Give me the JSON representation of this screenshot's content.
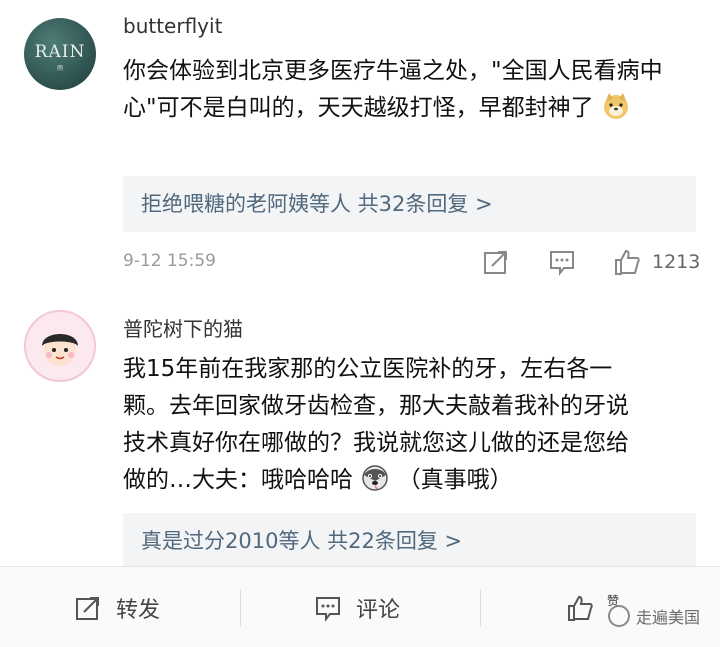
{
  "comments": [
    {
      "username": "butterflyit",
      "avatar_text": "RAIN",
      "avatar_subtext": "雨",
      "text": "你会体验到北京更多医疗牛逼之处，\"全国人民看病中心\"可不是白叫的，天天越级打怪，早都封神了",
      "emoji": "doge-emoji",
      "replies_summary": "拒绝喂糖的老阿姨等人  共32条回复 >",
      "timestamp": "9-12 15:59",
      "like_count": "1213"
    },
    {
      "username": "普陀树下的猫",
      "text_line1": "我15年前在我家那的公立医院补的牙，左右各一",
      "text_line2": "颗。去年回家做牙齿检查，那大夫敲着我补的牙说",
      "text_line3": "技术真好你在哪做的？我说就您这儿做的还是您给",
      "text_line4a": "做的…大夫：哦哈哈哈",
      "text_line4b": "（真事哦）",
      "emoji": "husky-emoji",
      "replies_summary": "真是过分2010等人  共22条回复 >"
    }
  ],
  "bottom_bar": {
    "repost_label": "转发",
    "comment_label": "评论",
    "like_partial": "赞",
    "watermark": "走遍美国"
  },
  "colors": {
    "link_blue": "#51687d",
    "reply_bg": "#f3f4f6",
    "meta_gray": "#9a9a9a"
  }
}
